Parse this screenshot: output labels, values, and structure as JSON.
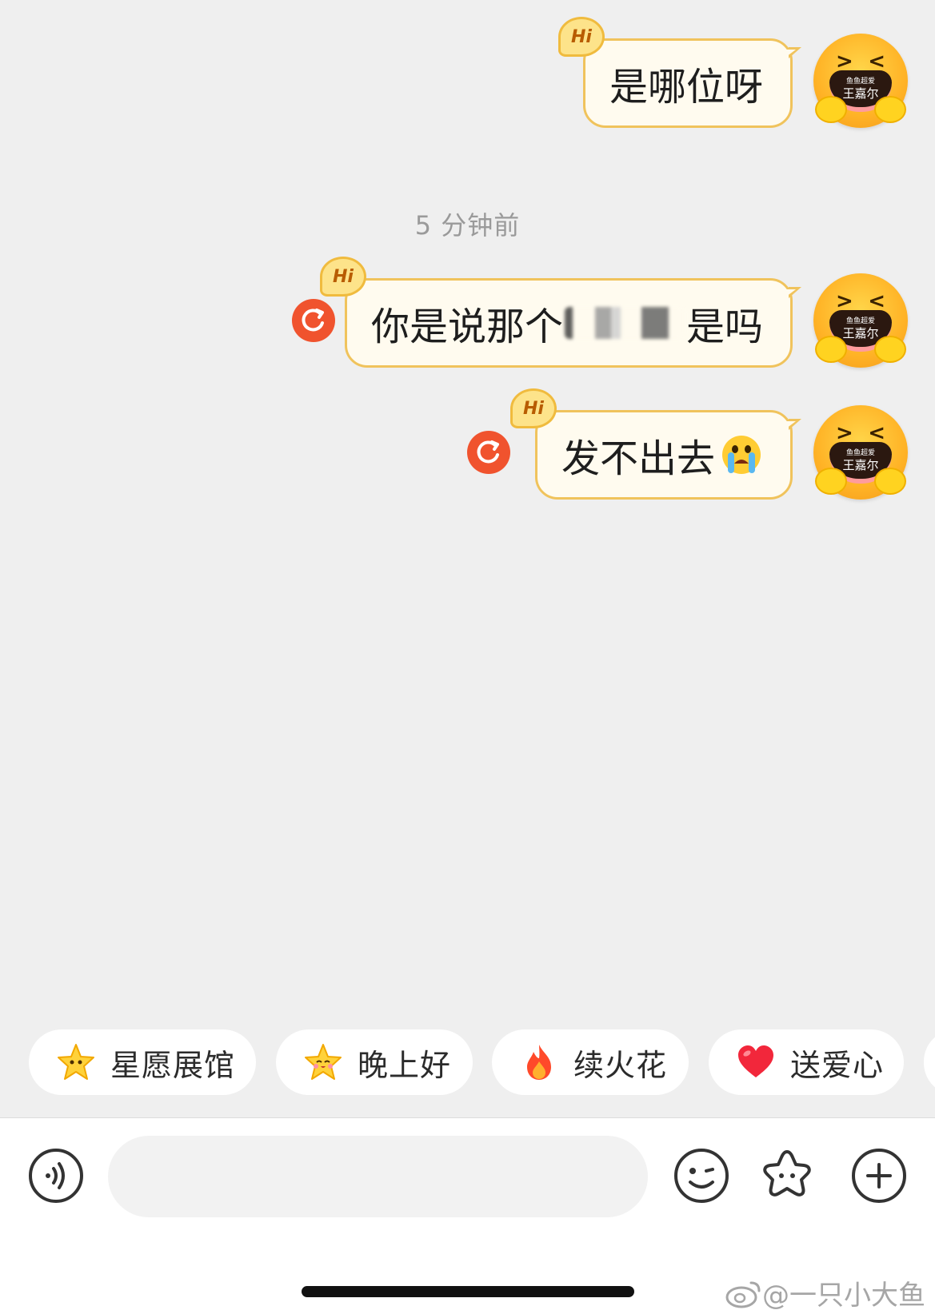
{
  "messages": [
    {
      "text": "是哪位呀",
      "badge": "Hi",
      "failed": false
    },
    {
      "text_before": "你是说那个",
      "text_after": "是吗",
      "badge": "Hi",
      "failed": true,
      "redacted": true
    },
    {
      "text": "发不出去",
      "badge": "Hi",
      "failed": true,
      "emoji": "crying-face"
    }
  ],
  "avatar": {
    "caption_small": "鱼鱼超爱",
    "caption_name": "王嘉尔",
    "eyes_left": "&gt;",
    "eyes_right": "&lt;"
  },
  "timestamp": "5 分钟前",
  "chips": [
    {
      "label": "星愿展馆",
      "icon": "star-smile-icon"
    },
    {
      "label": "晚上好",
      "icon": "star-blush-icon"
    },
    {
      "label": "续火花",
      "icon": "fire-icon"
    },
    {
      "label": "送爱心",
      "icon": "heart-icon"
    }
  ],
  "input": {
    "placeholder": "",
    "value": ""
  },
  "watermark": "@一只小大鱼",
  "colors": {
    "background": "#efefef",
    "bubble_fill": "#fffbef",
    "bubble_border": "#f0c35c",
    "resend": "#f0532e",
    "timestamp": "#9a9a9a"
  }
}
